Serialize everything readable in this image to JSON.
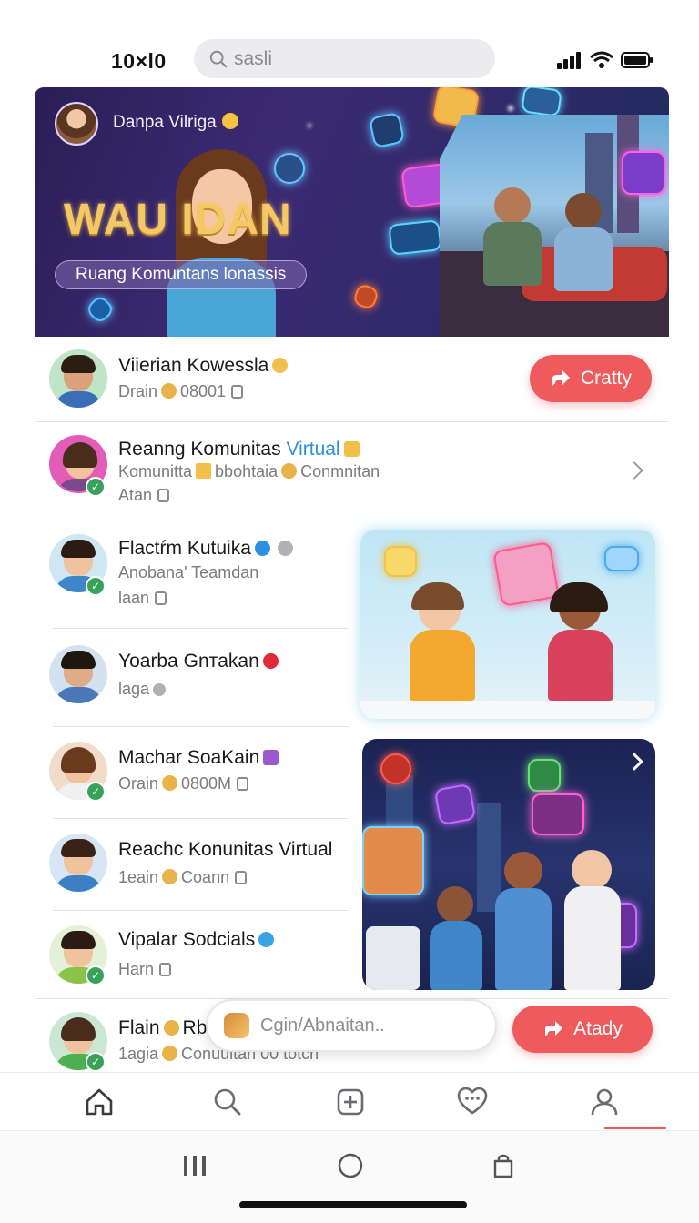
{
  "status_bar": {
    "time": "10×l0",
    "search_placeholder": "sasli"
  },
  "hero": {
    "user_name": "Danpa Vilriga",
    "title": "WAU  IDAN",
    "subtitle": "Ruang Komuntans lonassis"
  },
  "list": [
    {
      "name": "Viierian Kowessla",
      "meta": [
        "Drain",
        "08001"
      ],
      "action_label": "Cratty"
    },
    {
      "name_prefix": "Reanng Komunitas ",
      "name_highlight": "Virtual",
      "meta_line1": [
        "Komunitta",
        "bbohtaia",
        "Conmnitan"
      ],
      "meta_line2": "Atan"
    },
    {
      "name": "Flactŕm Kutuika",
      "meta_line1": "Anobana' Teamdan",
      "meta_line2": "laan"
    },
    {
      "name": "Yoarba Gnтakan",
      "meta": "laga"
    },
    {
      "name": "Machar SoaKain",
      "meta": [
        "Orain",
        "0800М"
      ]
    },
    {
      "name": "Reachc Konunitas Virtual",
      "meta": [
        "1eain",
        "Coann"
      ]
    },
    {
      "name": "Vipalar Sodcials",
      "meta": "Harn"
    },
    {
      "name": "Flain",
      "name_suffix": "Rbu",
      "meta": [
        "1agia",
        "Conuuitan 00 totcn"
      ],
      "action_label": "Atady"
    }
  ],
  "composer": {
    "placeholder": "Cgin/Abnaitan.."
  },
  "tabs": [
    "home",
    "search",
    "create",
    "chat",
    "profile"
  ],
  "colors": {
    "accent_red": "#ef5a5c",
    "highlight_blue": "#2c8fe0",
    "verified_green": "#39a25a"
  }
}
